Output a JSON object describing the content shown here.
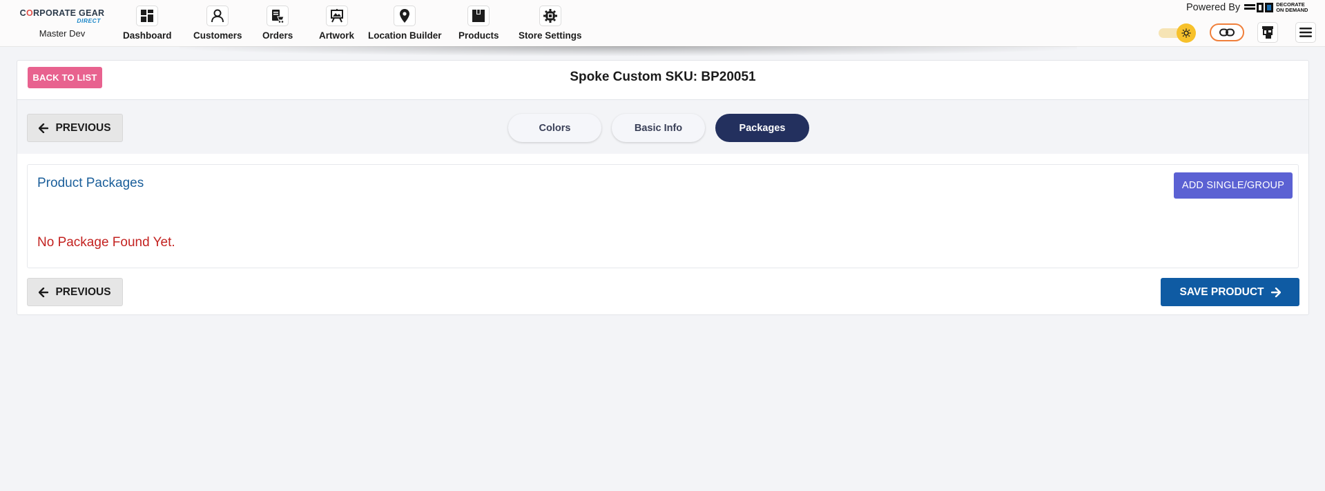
{
  "brand": {
    "logo_text": "CORPORATE GEAR",
    "logo_sub": "DIRECT",
    "user_name": "Master Dev"
  },
  "nav": {
    "items": [
      {
        "label": "Dashboard",
        "icon": "dashboard-icon"
      },
      {
        "label": "Customers",
        "icon": "customer-icon"
      },
      {
        "label": "Orders",
        "icon": "orders-icon"
      },
      {
        "label": "Artwork",
        "icon": "artwork-icon"
      },
      {
        "label": "Location Builder",
        "icon": "location-pin-icon"
      },
      {
        "label": "Products",
        "icon": "box-icon"
      },
      {
        "label": "Store Settings",
        "icon": "settings-gear-icon"
      }
    ]
  },
  "header_right": {
    "powered_by": "Powered By",
    "partner_logo_text": "DECORATE ON DEMAND",
    "theme_toggle_icon": "sun-icon",
    "link_icon": "link-icon",
    "store_icon": "storefront-icon",
    "menu_icon": "hamburger-menu-icon"
  },
  "page": {
    "back_label": "BACK TO LIST",
    "title": "Spoke Custom SKU: BP20051"
  },
  "steps": {
    "previous_label": "PREVIOUS",
    "tabs": [
      {
        "label": "Colors",
        "active": false
      },
      {
        "label": "Basic Info",
        "active": false
      },
      {
        "label": "Packages",
        "active": true
      }
    ]
  },
  "packages": {
    "title": "Product Packages",
    "add_label": "ADD SINGLE/GROUP",
    "empty_message": "No Package Found Yet."
  },
  "footer": {
    "previous_label": "PREVIOUS",
    "save_label": "SAVE PRODUCT"
  },
  "colors": {
    "back_button": "#e8628f",
    "active_tab": "#23305e",
    "add_button": "#5b61d3",
    "save_button": "#0f5ba3",
    "panel_title": "#1a5e9a",
    "empty_message": "#c32220",
    "toggle": "#f7c12b",
    "link_border": "#f07f3a"
  }
}
